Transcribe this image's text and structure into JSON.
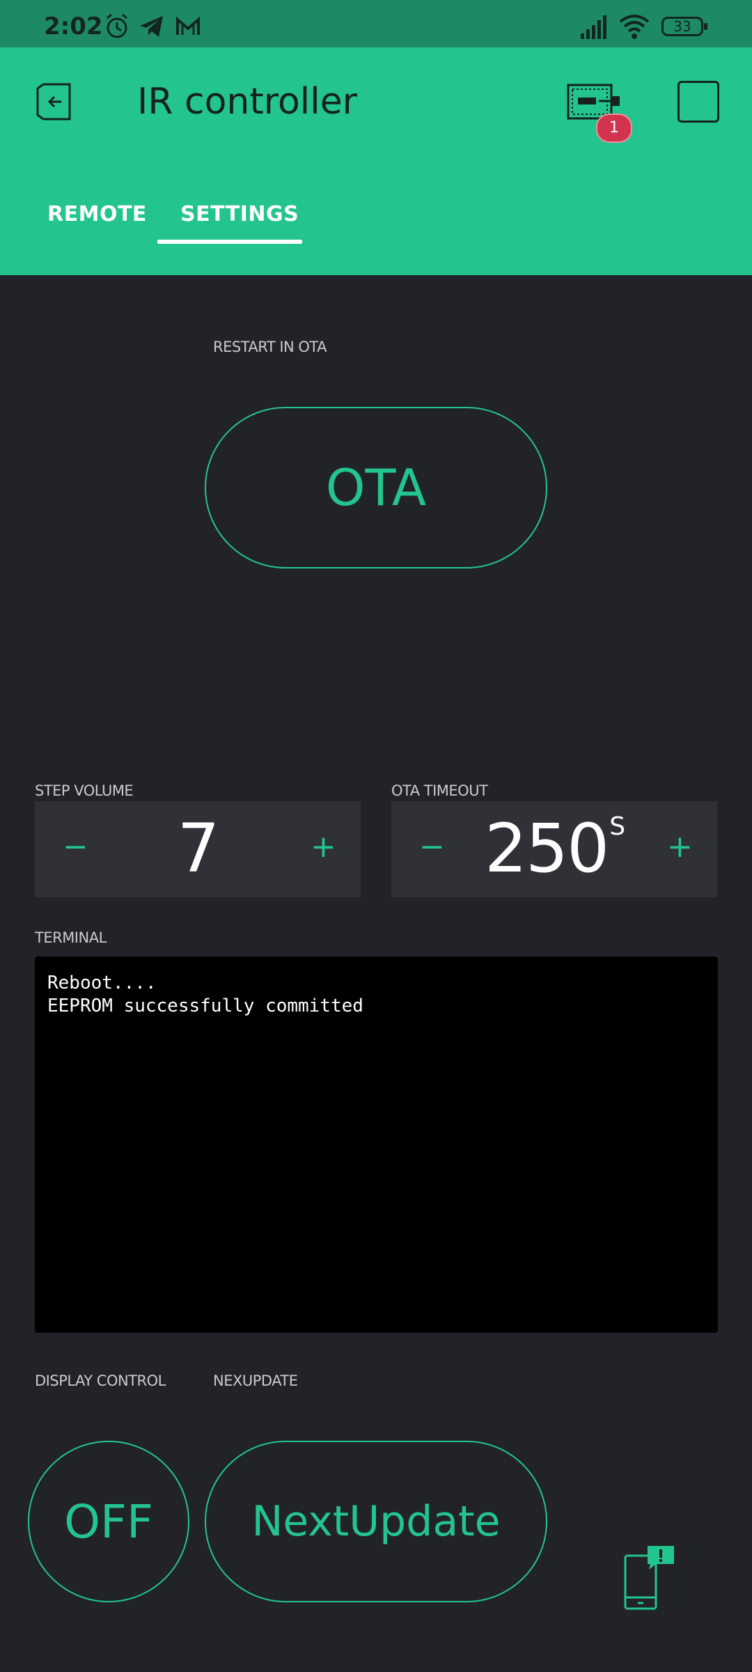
{
  "status_bar": {
    "time": "2:02",
    "battery": "33"
  },
  "header": {
    "title": "IR controller",
    "device_badge": "1"
  },
  "tabs": [
    {
      "label": "REMOTE"
    },
    {
      "label": "SETTINGS"
    }
  ],
  "restart": {
    "label": "RESTART IN OTA",
    "button": "OTA"
  },
  "step_volume": {
    "label": "STEP VOLUME",
    "value": "7",
    "minus": "−",
    "plus": "+"
  },
  "ota_timeout": {
    "label": "OTA TIMEOUT",
    "value": "250",
    "unit": "S",
    "minus": "−",
    "plus": "+"
  },
  "terminal": {
    "label": "TERMINAL",
    "lines": [
      "Reboot....",
      "EEPROM successfully committed"
    ]
  },
  "display_control": {
    "label": "DISPLAY CONTROL",
    "button": "OFF"
  },
  "nexupdate": {
    "label": "NEXUPDATE",
    "button": "NextUpdate"
  },
  "colors": {
    "accent": "#23c48e",
    "background": "#222328",
    "statusbar": "#1e8a64",
    "badge": "#d2334f"
  }
}
